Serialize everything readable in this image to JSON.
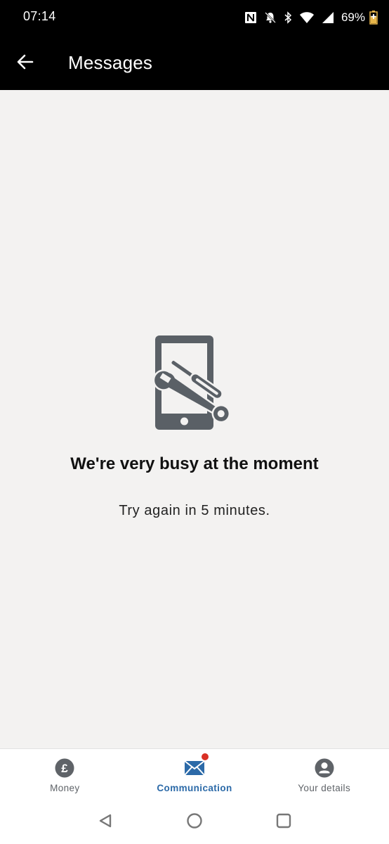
{
  "status_bar": {
    "time": "07:14",
    "battery_percent": "69%",
    "icons": [
      "nfc-icon",
      "notifications-off-icon",
      "bluetooth-icon",
      "wifi-icon",
      "cellular-signal-icon",
      "battery-charging-icon"
    ]
  },
  "app_bar": {
    "title": "Messages",
    "back_icon": "arrow-left-icon"
  },
  "empty_state": {
    "illustration": "phone-tools-icon",
    "headline": "We're very busy at the moment",
    "message": "Try again in 5 minutes."
  },
  "bottom_nav": {
    "items": [
      {
        "label": "Money",
        "icon": "pound-circle-icon",
        "active": false
      },
      {
        "label": "Communication",
        "icon": "envelope-icon",
        "active": true,
        "badge": true
      },
      {
        "label": "Your details",
        "icon": "account-circle-icon",
        "active": false
      }
    ]
  },
  "colors": {
    "accent": "#2c6aa8",
    "badge": "#d93025",
    "icon_gray": "#5a6066",
    "background": "#f3f2f1"
  },
  "system_nav": {
    "buttons": [
      "back-triangle-icon",
      "home-circle-icon",
      "recents-square-icon"
    ]
  }
}
